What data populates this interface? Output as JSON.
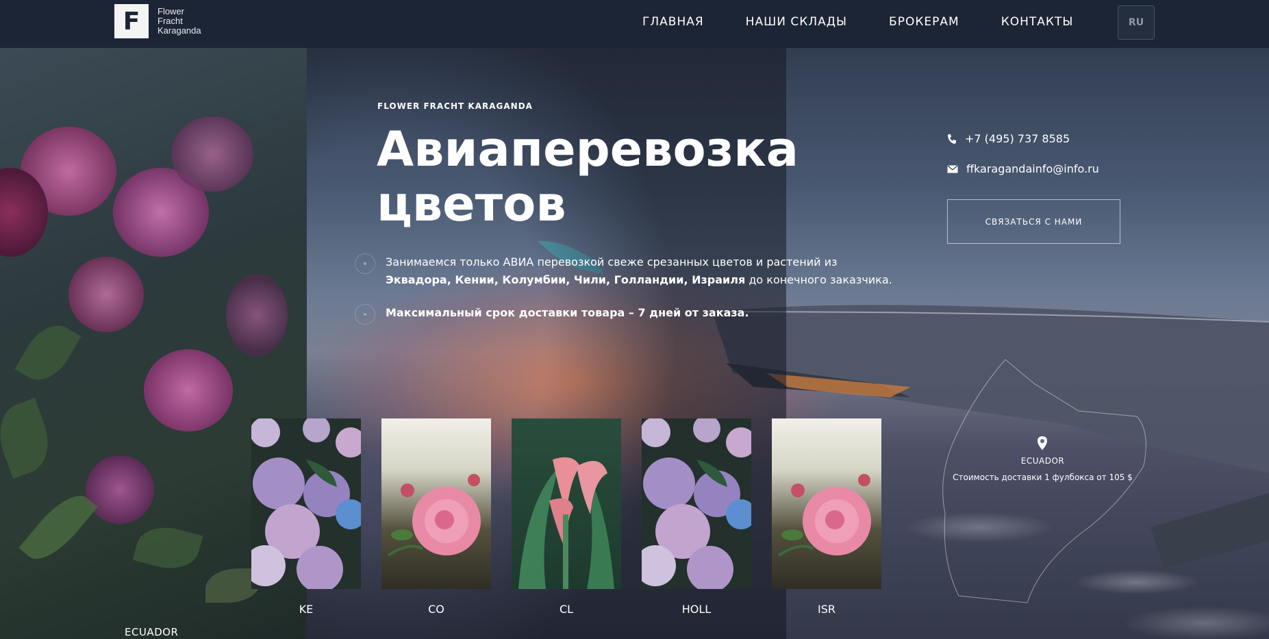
{
  "header": {
    "logo_letter": "F",
    "logo_line1": "Flower",
    "logo_line2": "Fracht",
    "logo_line3": "Karaganda",
    "nav": [
      "ГЛАВНАЯ",
      "НАШИ СКЛАДЫ",
      "БРОКЕРАМ",
      "КОНТАКТЫ"
    ],
    "lang": "RU"
  },
  "hero": {
    "kicker": "FLOWER FRACHT KARAGANDA",
    "title_line1": "Авиаперевозка",
    "title_line2": "цветов",
    "bullet1_text": "Занимаемся только АВИА перевозкой свеже срезанных цветов и растений из",
    "bullet1_bold": "Эквадора, Кении, Колумбии, Чили, Голландии, Израиля",
    "bullet1_tail": "до конечного заказчика.",
    "bullet2_bold": "Максимальный срок доставки товара – 7 дней от заказа."
  },
  "contact": {
    "phone": "+7 (495) 737 8585",
    "email": "ffkaragandainfo@info.ru",
    "button": "СВЯЗАТЬСЯ С НАМИ"
  },
  "map": {
    "country": "ECUADOR",
    "price": "Стоимость доставки 1 фулбокса от 105 $"
  },
  "cards": [
    {
      "label": "KE",
      "image": "hydrangea"
    },
    {
      "label": "CO",
      "image": "pink-rose"
    },
    {
      "label": "CL",
      "image": "calla-lily"
    },
    {
      "label": "HOLL",
      "image": "hydrangea"
    },
    {
      "label": "ISR",
      "image": "pink-rose"
    }
  ],
  "bottom_label": "ECUADOR",
  "colors": {
    "header_bg": "#1c2535",
    "text": "#ffffff"
  }
}
